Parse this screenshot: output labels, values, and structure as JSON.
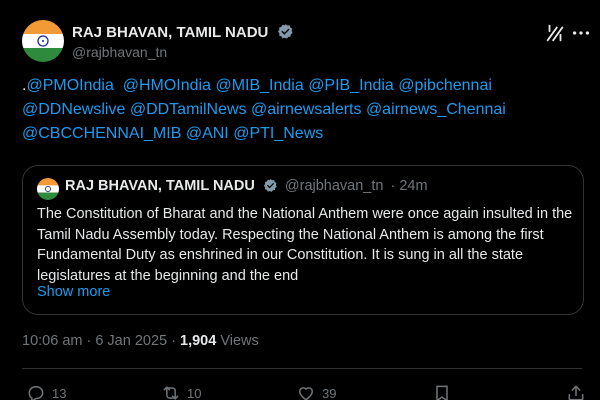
{
  "author": {
    "name": "RAJ BHAVAN, TAMIL NADU",
    "handle": "@rajbhavan_tn",
    "verified_color": "#829aab"
  },
  "tweet": {
    "lead": ".",
    "mentions_line1": [
      "@PMOIndia",
      "@HMOIndia",
      "@MIB_India",
      "@PIB_India",
      "@pibchennai"
    ],
    "mentions_line2": [
      "@DDNewslive",
      "@DDTamilNews",
      "@airnewsalerts",
      "@airnews_Chennai"
    ],
    "mentions_line3": [
      "@CBCCHENNAI_MIB",
      "@ANI",
      "@PTI_News"
    ]
  },
  "quote": {
    "name": "RAJ BHAVAN, TAMIL NADU",
    "handle": "@rajbhavan_tn",
    "time": "· 24m",
    "text": "The Constitution of Bharat and the National Anthem were once again insulted in the Tamil Nadu Assembly today. Respecting the National Anthem is among the first Fundamental Duty as enshrined in our Constitution. It is sung in all the state legislatures at the beginning and the end",
    "show_more": "Show more"
  },
  "meta": {
    "time": "10:06 am · 6 Jan 2025 · ",
    "views_count": "1,904",
    "views_label": " Views"
  },
  "actions": {
    "replies": "13",
    "reposts": "10",
    "likes": "39"
  },
  "icons": {
    "grok": "grok-icon",
    "more": "more-icon",
    "reply": "reply-icon",
    "repost": "repost-icon",
    "like": "heart-icon",
    "share": "share-icon"
  },
  "colors": {
    "accent": "#1d9bf0",
    "muted": "#71767b",
    "text": "#e7e9ea",
    "border": "#2f3336"
  }
}
